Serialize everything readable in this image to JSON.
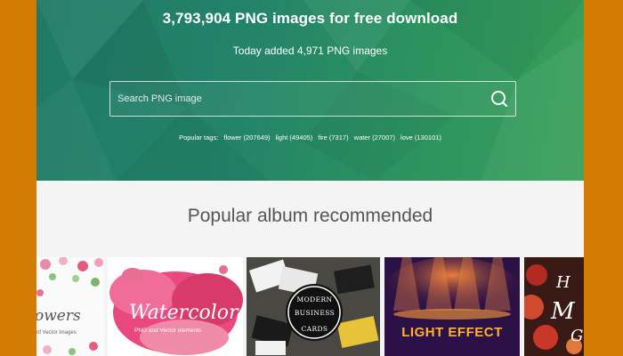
{
  "colors": {
    "page_border": "#d37a05",
    "hero_start": "#1f7a66",
    "hero_end": "#3aa05a",
    "section_bg": "#f4f4f4",
    "section_title": "#555555"
  },
  "hero": {
    "title": "3,793,904 PNG images for free download",
    "subtitle": "Today added 4,971 PNG images",
    "search": {
      "placeholder": "Search PNG image",
      "value": "",
      "icon": "search-icon"
    },
    "popular_tags": {
      "label": "Popular tags:",
      "items": [
        {
          "text": "flower (207649)"
        },
        {
          "text": "light (49405)"
        },
        {
          "text": "fire (7317)"
        },
        {
          "text": "water (27007)"
        },
        {
          "text": "love (130101)"
        }
      ]
    }
  },
  "albums": {
    "title": "Popular album recommended",
    "items": [
      {
        "title": "owers",
        "subtitle": "of Vector images"
      },
      {
        "title": "Watercolor",
        "subtitle": "PNG and Vector elements"
      },
      {
        "line1": "MODERN",
        "line2": "BUSINESS",
        "line3": "CARDS"
      },
      {
        "title": "LIGHT EFFECT"
      },
      {
        "line1": "H",
        "line2": "M",
        "line3": "G"
      }
    ]
  }
}
